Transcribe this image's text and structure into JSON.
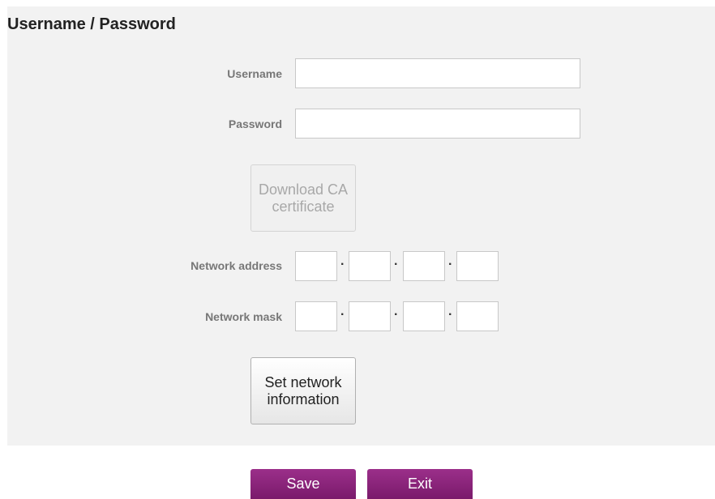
{
  "section": {
    "title": "Username / Password"
  },
  "form": {
    "username_label": "Username",
    "username_value": "",
    "password_label": "Password",
    "password_value": "",
    "download_ca_label": "Download CA certificate",
    "network_address_label": "Network address",
    "network_address_octets": [
      "",
      "",
      "",
      ""
    ],
    "network_mask_label": "Network mask",
    "network_mask_octets": [
      "",
      "",
      "",
      ""
    ],
    "octet_separator": "·",
    "set_network_label": "Set network information"
  },
  "footer": {
    "save_label": "Save",
    "exit_label": "Exit"
  },
  "colors": {
    "panel_background": "#f2f2f2",
    "label_text": "#777777",
    "primary_button": "#8a2279"
  }
}
